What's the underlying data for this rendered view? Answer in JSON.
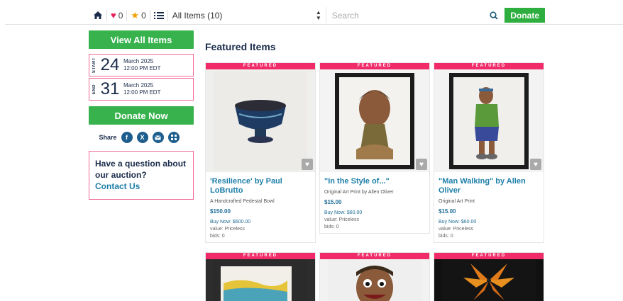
{
  "toolbar": {
    "favorites_count": "0",
    "watch_count": "0",
    "category_select": "All Items (10)",
    "search_placeholder": "Search",
    "donate_label": "Donate"
  },
  "sidebar": {
    "view_all_label": "View All Items",
    "start": {
      "label": "START",
      "day": "24",
      "month": "March 2025",
      "time": "12:00 PM EDT"
    },
    "end": {
      "label": "END",
      "day": "31",
      "month": "March 2025",
      "time": "12:00 PM EDT"
    },
    "donate_now_label": "Donate Now",
    "share_label": "Share",
    "question_text": "Have a question about our auction?",
    "contact_label": "Contact Us"
  },
  "main": {
    "title": "Featured Items",
    "banner_label": "FEATURED",
    "items": [
      {
        "title": "'Resilience' by Paul LoBrutto",
        "subtitle": "A Handcrafted Pedestal Bowl",
        "price": "$150.00",
        "buy_now": "Buy Now: $600.00",
        "value": "value: Priceless",
        "bids": "bids: 0"
      },
      {
        "title": "\"In the Style of...\"",
        "subtitle": "Original Art Print by Allen Oliver",
        "price": "$15.00",
        "buy_now": "Buy Now: $60.00",
        "value": "value: Priceless",
        "bids": "bids: 0"
      },
      {
        "title": "\"Man Walking\" by Allen Oliver",
        "subtitle": "Original Art Print",
        "price": "$15.00",
        "buy_now": "Buy Now: $60.00",
        "value": "value: Priceless",
        "bids": "bids: 0"
      }
    ]
  }
}
